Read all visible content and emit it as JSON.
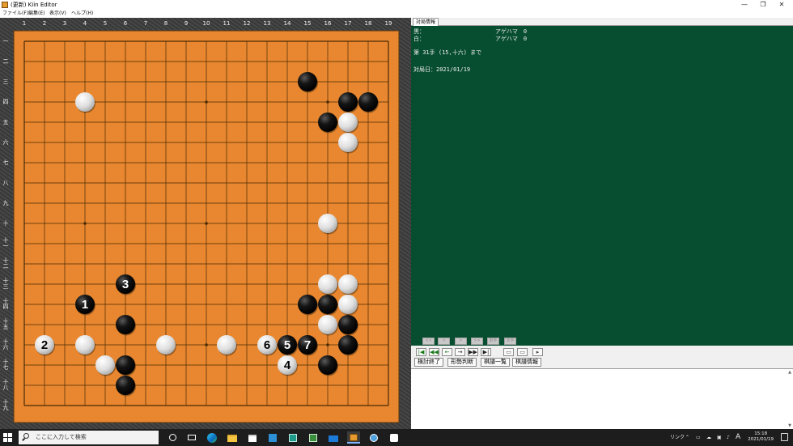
{
  "window": {
    "title": "(更新) Kiin Editor",
    "controls": [
      "—",
      "❐",
      "✕"
    ]
  },
  "menu": [
    {
      "label": "ファイル(F)"
    },
    {
      "label": "編集(E)"
    },
    {
      "label": "表示(V)"
    },
    {
      "label": "ヘルプ(H)"
    }
  ],
  "board": {
    "size": 19,
    "col_labels": [
      "1",
      "2",
      "3",
      "4",
      "5",
      "6",
      "7",
      "8",
      "9",
      "10",
      "11",
      "12",
      "13",
      "14",
      "15",
      "16",
      "17",
      "18",
      "19"
    ],
    "row_labels": [
      "一",
      "二",
      "三",
      "四",
      "五",
      "六",
      "七",
      "八",
      "九",
      "十",
      "十一",
      "十二",
      "十三",
      "十四",
      "十五",
      "十六",
      "十七",
      "十八",
      "十九"
    ],
    "star_points": [
      [
        4,
        4
      ],
      [
        10,
        4
      ],
      [
        16,
        4
      ],
      [
        4,
        10
      ],
      [
        10,
        10
      ],
      [
        16,
        10
      ],
      [
        4,
        16
      ],
      [
        10,
        16
      ],
      [
        16,
        16
      ]
    ],
    "colors": {
      "board": "#e8872f",
      "line": "#4a2a05",
      "frame": "#3d3d3d"
    },
    "stones": [
      {
        "col": 15,
        "row": 3,
        "color": "black"
      },
      {
        "col": 4,
        "row": 4,
        "color": "white"
      },
      {
        "col": 17,
        "row": 4,
        "color": "black"
      },
      {
        "col": 18,
        "row": 4,
        "color": "black"
      },
      {
        "col": 16,
        "row": 5,
        "color": "black"
      },
      {
        "col": 17,
        "row": 5,
        "color": "white"
      },
      {
        "col": 17,
        "row": 6,
        "color": "white"
      },
      {
        "col": 16,
        "row": 10,
        "color": "white"
      },
      {
        "col": 16,
        "row": 13,
        "color": "white"
      },
      {
        "col": 17,
        "row": 13,
        "color": "white"
      },
      {
        "col": 15,
        "row": 14,
        "color": "black"
      },
      {
        "col": 16,
        "row": 14,
        "color": "black"
      },
      {
        "col": 17,
        "row": 14,
        "color": "white"
      },
      {
        "col": 6,
        "row": 15,
        "color": "black"
      },
      {
        "col": 16,
        "row": 15,
        "color": "white"
      },
      {
        "col": 17,
        "row": 15,
        "color": "black"
      },
      {
        "col": 4,
        "row": 16,
        "color": "white"
      },
      {
        "col": 8,
        "row": 16,
        "color": "white"
      },
      {
        "col": 11,
        "row": 16,
        "color": "white"
      },
      {
        "col": 17,
        "row": 16,
        "color": "black"
      },
      {
        "col": 5,
        "row": 17,
        "color": "white"
      },
      {
        "col": 6,
        "row": 17,
        "color": "black"
      },
      {
        "col": 16,
        "row": 17,
        "color": "black"
      },
      {
        "col": 6,
        "row": 18,
        "color": "black"
      },
      {
        "col": 4,
        "row": 14,
        "color": "black",
        "label": "1"
      },
      {
        "col": 2,
        "row": 16,
        "color": "white",
        "label": "2"
      },
      {
        "col": 6,
        "row": 13,
        "color": "black",
        "label": "3"
      },
      {
        "col": 14,
        "row": 17,
        "color": "white",
        "label": "4"
      },
      {
        "col": 14,
        "row": 16,
        "color": "black",
        "label": "5"
      },
      {
        "col": 13,
        "row": 16,
        "color": "white",
        "label": "6"
      },
      {
        "col": 15,
        "row": 16,
        "color": "black",
        "label": "7"
      }
    ]
  },
  "info_panel": {
    "tab": "対局情報",
    "black_label": "黒：",
    "white_label": "白：",
    "black_captures": "アゲハマ　0",
    "white_captures": "アゲハマ　0",
    "move_text": "第 31手 (15,十六) まで",
    "date_text": "対局日：2021/01/19"
  },
  "faded_nav": [
    "<<",
    "<",
    ">",
    ">>",
    "前手",
    "次手"
  ],
  "nav_buttons": [
    {
      "name": "first-move",
      "glyph": "|◀"
    },
    {
      "name": "back-many",
      "glyph": "◀◀"
    },
    {
      "name": "back",
      "glyph": "←"
    },
    {
      "name": "forward",
      "glyph": "→"
    },
    {
      "name": "forward-many",
      "glyph": "▶▶"
    },
    {
      "name": "last-move",
      "glyph": "▶|"
    },
    {
      "name": "view-a",
      "glyph": "▭"
    },
    {
      "name": "view-b",
      "glyph": "▭"
    },
    {
      "name": "next-page",
      "glyph": "▸"
    }
  ],
  "commands": [
    {
      "label": "検討終了"
    },
    {
      "label": "形勢判断"
    },
    {
      "label": "棋譜一覧"
    },
    {
      "label": "棋譜情報"
    }
  ],
  "taskbar": {
    "search_placeholder": "ここに入力して検索",
    "tray_link": "リンク",
    "ime": "A",
    "time": "15:18",
    "date": "2021/01/19"
  }
}
